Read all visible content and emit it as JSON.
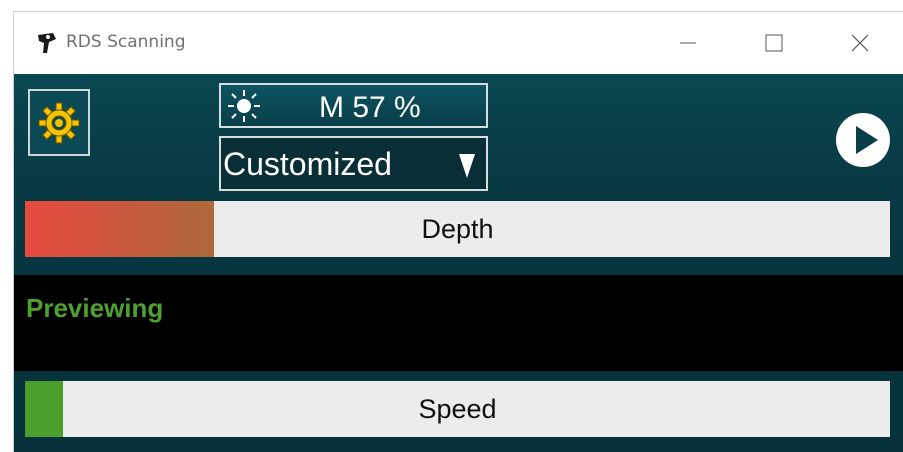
{
  "window": {
    "title": "RDS Scanning",
    "app_icon": "camera-icon",
    "controls": [
      "minimize-icon",
      "maximize-icon",
      "close-icon"
    ]
  },
  "toolbar": {
    "settings_icon": "gear-icon",
    "brightness": {
      "icon": "sun-icon",
      "value": "M 57 %"
    },
    "mode": {
      "selected": "Customized",
      "icon": "dropdown-arrow-icon"
    },
    "play_icon": "play-icon"
  },
  "depth_bar": {
    "label": "Depth",
    "fill_fraction": 0.218
  },
  "status": {
    "text": "Previewing"
  },
  "speed_bar": {
    "label": "Speed",
    "fill_fraction": 0.044
  },
  "colors": {
    "accent_green": "#4ea12f",
    "depth_start": "#e84a3f",
    "depth_end": "#ad6a3a",
    "panel_teal": "#073842",
    "gear_yellow": "#f5c400"
  }
}
